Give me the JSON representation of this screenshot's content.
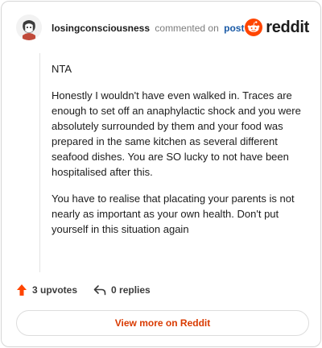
{
  "header": {
    "author": "losingconsciousness",
    "commented_text": "commented on",
    "post_link": "post",
    "brand": "reddit"
  },
  "comment": {
    "paragraphs": [
      "NTA",
      "Honestly I wouldn't have even walked in. Traces are enough to set off an anaphylactic shock and you were absolutely surrounded by them and your food was prepared in the same kitchen as several different seafood dishes. You are SO lucky to not have been hospitalised after this.",
      "You have to realise that placating your parents is not nearly as important as your own health. Don't put yourself in this situation again"
    ]
  },
  "actions": {
    "upvotes_label": "3 upvotes",
    "replies_label": "0 replies"
  },
  "footer": {
    "view_more_label": "View more on Reddit"
  },
  "colors": {
    "accent": "#d93a00",
    "upvote": "#ff4500",
    "link": "#1a5aa6"
  }
}
